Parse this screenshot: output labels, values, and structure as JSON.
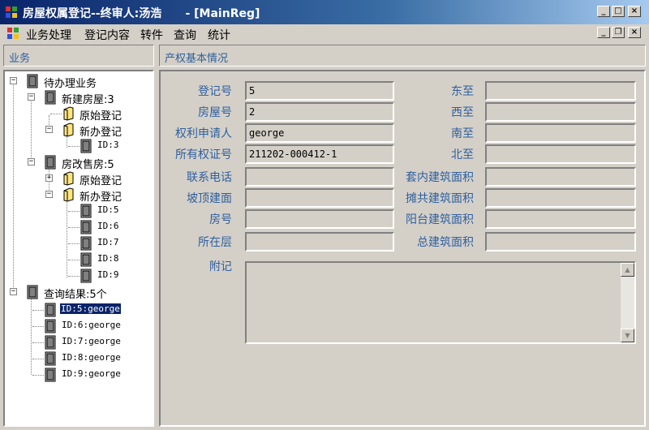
{
  "window": {
    "title": "房屋权属登记--终审人:汤浩      - [MainReg]",
    "controls": {
      "minimize": "_",
      "maximize": "□",
      "close": "×"
    }
  },
  "menu": {
    "items": [
      "业务处理",
      "登记内容",
      "转件",
      "查询",
      "统计"
    ],
    "mdi_controls": {
      "minimize": "_",
      "restore": "❐",
      "close": "×"
    }
  },
  "left_panel": {
    "header": "业务"
  },
  "right_panel": {
    "header": "产权基本情况"
  },
  "tree": {
    "root_pending": "待办理业务",
    "new_house": "新建房屋:3",
    "new_house_original": "原始登记",
    "new_house_new": "新办登记",
    "new_house_id": "ID:3",
    "reform_house": "房改售房:5",
    "reform_original": "原始登记",
    "reform_new": "新办登记",
    "reform_ids": [
      "ID:5",
      "ID:6",
      "ID:7",
      "ID:8",
      "ID:9"
    ],
    "query_results": "查询结果:5个",
    "result_items": [
      "ID:5:george",
      "ID:6:george",
      "ID:7:george",
      "ID:8:george",
      "ID:9:george"
    ],
    "selected_index": 0
  },
  "form": {
    "left_fields": [
      {
        "label": "登记号",
        "value": "5"
      },
      {
        "label": "房屋号",
        "value": "2"
      },
      {
        "label": "权利申请人",
        "value": "george"
      },
      {
        "label": "所有权证号",
        "value": "211202-000412-1"
      },
      {
        "label": "联系电话",
        "value": ""
      },
      {
        "label": "坡顶建面",
        "value": ""
      },
      {
        "label": "房号",
        "value": ""
      },
      {
        "label": "所在层",
        "value": ""
      }
    ],
    "right_fields": [
      {
        "label": "东至",
        "value": ""
      },
      {
        "label": "西至",
        "value": ""
      },
      {
        "label": "南至",
        "value": ""
      },
      {
        "label": "北至",
        "value": ""
      },
      {
        "label": "套内建筑面积",
        "value": ""
      },
      {
        "label": "摊共建筑面积",
        "value": ""
      },
      {
        "label": "阳台建筑面积",
        "value": ""
      },
      {
        "label": "总建筑面积",
        "value": ""
      }
    ],
    "remarks_label": "附记",
    "remarks_value": ""
  },
  "colors": {
    "title_bar": "#0a246a",
    "label_text": "#2f5f9f",
    "selection": "#0a246a"
  }
}
